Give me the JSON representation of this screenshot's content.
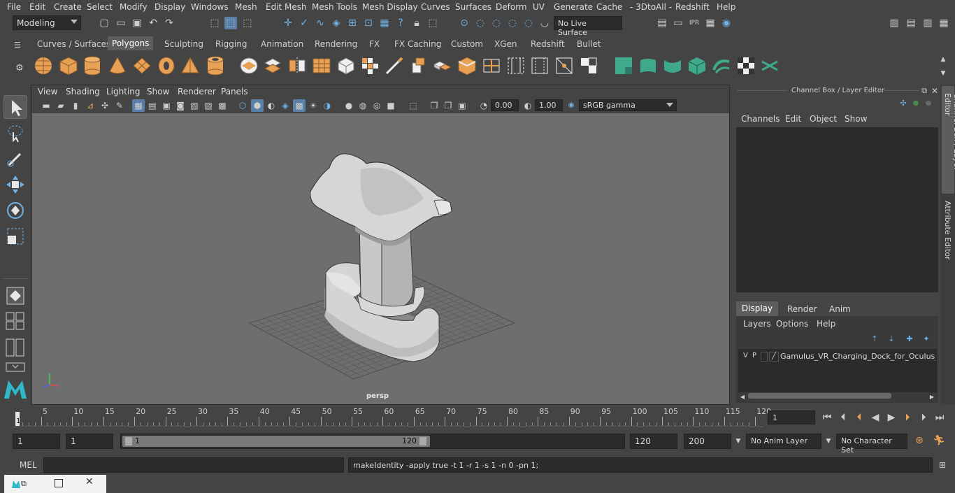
{
  "menubar": {
    "items": [
      "File",
      "Edit",
      "Create",
      "Select",
      "Modify",
      "Display",
      "Windows",
      "Mesh",
      "Edit Mesh",
      "Mesh Tools",
      "Mesh Display",
      "Curves",
      "Surfaces",
      "Deform",
      "UV",
      "Generate",
      "Cache",
      "- 3DtoAll -",
      "Redshift",
      "Help"
    ]
  },
  "status": {
    "mode": "Modeling",
    "live_surface": "No Live Surface"
  },
  "shelf": {
    "tabs": [
      "Curves / Surfaces",
      "Polygons",
      "Sculpting",
      "Rigging",
      "Animation",
      "Rendering",
      "FX",
      "FX Caching",
      "Custom",
      "XGen",
      "Redshift",
      "Bullet"
    ],
    "active_tab": "Polygons"
  },
  "viewport": {
    "menus": [
      "View",
      "Shading",
      "Lighting",
      "Show",
      "Renderer",
      "Panels"
    ],
    "exposure": "0.00",
    "gamma": "1.00",
    "color_space": "sRGB gamma",
    "camera_label": "persp"
  },
  "channel_box": {
    "title": "Channel Box / Layer Editor",
    "menus": [
      "Channels",
      "Edit",
      "Object",
      "Show"
    ],
    "layer_tabs": [
      "Display",
      "Render",
      "Anim"
    ],
    "active_layer_tab": "Display",
    "layer_menus": [
      "Layers",
      "Options",
      "Help"
    ],
    "layer": {
      "v": "V",
      "p": "P",
      "name": "Gamulus_VR_Charging_Dock_for_Oculus_Q"
    }
  },
  "side_tabs": {
    "channel_box": "Channel Box / Layer Editor",
    "attribute_editor": "Attribute Editor"
  },
  "timeline": {
    "ticks": [
      "5",
      "10",
      "15",
      "20",
      "25",
      "30",
      "35",
      "40",
      "45",
      "50",
      "55",
      "60",
      "65",
      "70",
      "75",
      "80",
      "85",
      "90",
      "95",
      "100",
      "105",
      "110",
      "115",
      "120"
    ],
    "start_marker": "1",
    "current_frame": "1"
  },
  "range": {
    "start": "1",
    "playback_start": "1",
    "slider_start": "1",
    "slider_end": "120",
    "playback_end": "120",
    "end": "200",
    "anim_layer": "No Anim Layer",
    "character_set": "No Character Set"
  },
  "command": {
    "lang": "MEL",
    "output": "makeIdentity -apply true -t 1 -r 1 -s 1 -n 0 -pn 1;"
  },
  "colors": {
    "accent": "#5a7fa8",
    "shelf_poly": "#e8a055",
    "shelf_green": "#3fa98c",
    "viewport_bg": "#6e6e6e",
    "grid": "#555555",
    "model": "#d2d2d2"
  }
}
